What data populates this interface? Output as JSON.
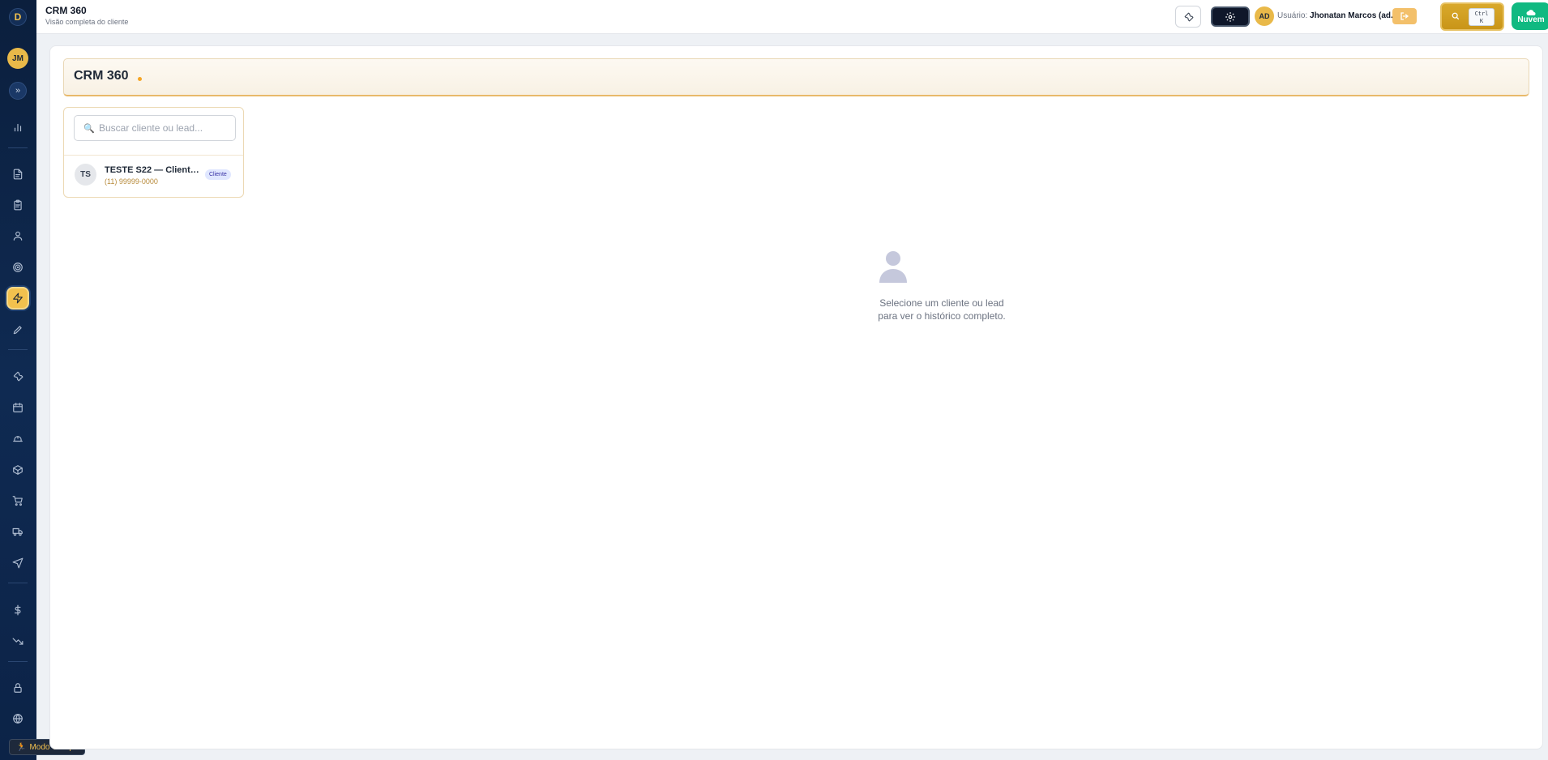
{
  "app": {
    "logo_letter": "D",
    "user_initials_sidebar": "JM",
    "expand_glyph": "»"
  },
  "topbar": {
    "title": "CRM 360",
    "subtitle": "Visão completa do cliente",
    "user_avatar": "AD",
    "user_prefix": "Usuário: ",
    "user_name": "Jhonatan Marcos (ad...",
    "shortcut": "Ctrl K",
    "shortcut_line1": "Ctrl",
    "shortcut_line2": "K",
    "cloud_label": "Nuvem"
  },
  "sidebar": {
    "icons": [
      "chart-icon",
      "document-icon",
      "clipboard-icon",
      "user-icon",
      "target-icon",
      "lightning-icon",
      "pencil-icon",
      "wrench-icon",
      "calendar-icon",
      "hard-hat-icon",
      "package-icon",
      "cart-icon",
      "truck-icon",
      "send-icon",
      "dollar-icon",
      "trending-down-icon",
      "lock-icon",
      "globe-icon"
    ],
    "active": "lightning-icon",
    "modo_campo": "Modo Campo"
  },
  "main": {
    "header_title": "CRM 360",
    "search_placeholder": "Buscar cliente ou lead...",
    "items": [
      {
        "initials": "TS",
        "name": "TESTE S22 — Cliente...",
        "phone": "(11) 99999-0000",
        "badge": "Cliente"
      }
    ],
    "empty_line1": "Selecione um cliente ou lead",
    "empty_line2": "para ver o histórico completo."
  },
  "colors": {
    "sidebar_bg": "#0b1f3d",
    "accent_gold": "#f2c14e",
    "cloud_green": "#10b981"
  }
}
